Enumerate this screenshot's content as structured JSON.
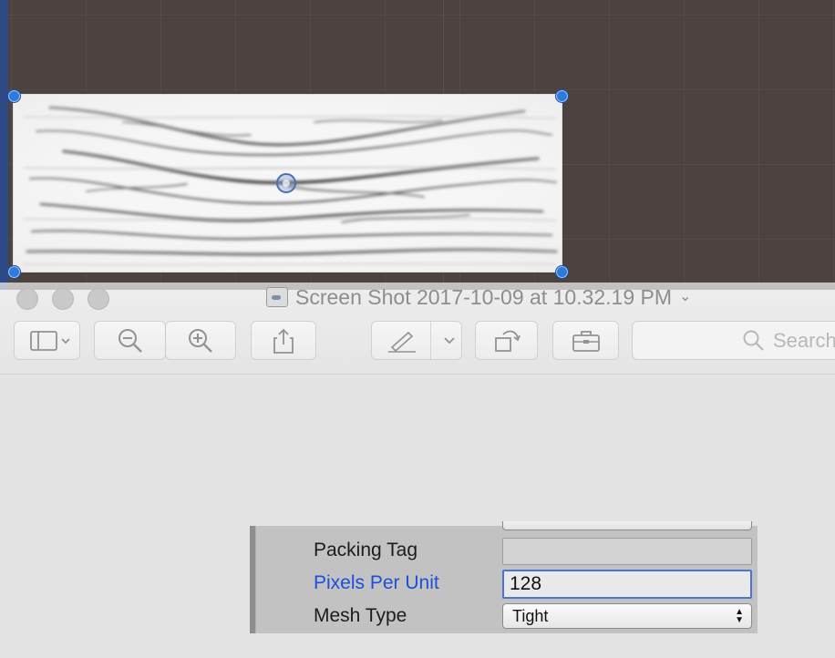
{
  "preview_window": {
    "title": "Screen Shot 2017-10-09 at 10.32.19 PM",
    "title_chevron": "⌄",
    "search_placeholder": "Search",
    "icons": [
      "sidebar-icon",
      "chevron-down-icon",
      "zoom-out-icon",
      "zoom-in-icon",
      "share-icon",
      "markup-pen-icon",
      "rotate-icon",
      "toolbox-icon",
      "search-icon"
    ]
  },
  "inspector": {
    "rows": [
      {
        "label": "Packing Tag",
        "value": ""
      },
      {
        "label": "Pixels Per Unit",
        "value": "128"
      },
      {
        "label": "Mesh Type",
        "value": "Tight"
      }
    ]
  },
  "colors": {
    "scene_background": "#4c4240",
    "handle": "#2f7ae0",
    "active_field_border": "#4a75d6",
    "label_highlight": "#1d4fd8"
  }
}
